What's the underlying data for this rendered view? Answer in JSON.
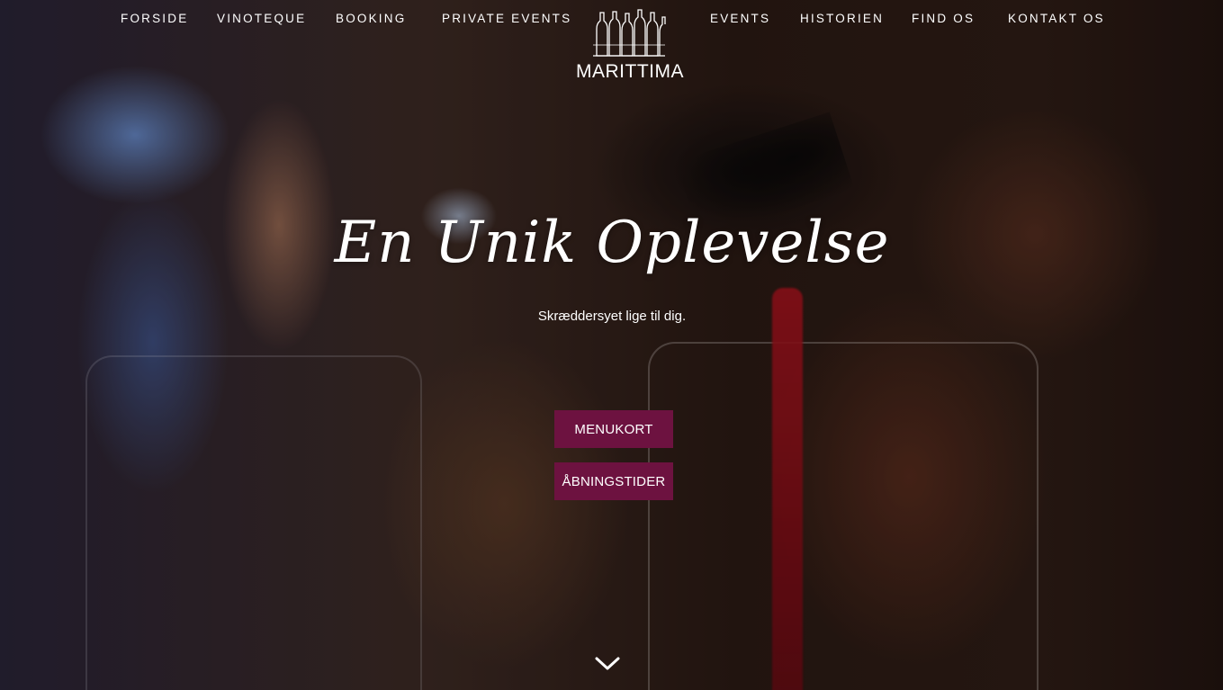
{
  "nav": {
    "left_links": [
      {
        "label": "FORSIDE"
      },
      {
        "label": "VINOTEQUE"
      },
      {
        "label": "BOOKING"
      },
      {
        "label": "PRIVATE EVENTS"
      }
    ],
    "right_links": [
      {
        "label": "EVENTS"
      },
      {
        "label": "HISTORIEN"
      },
      {
        "label": "FIND OS"
      },
      {
        "label": "KONTAKT OS"
      }
    ],
    "logo_text": "MARITTIMA",
    "logo_icon": "wine-bottles-icon"
  },
  "hero": {
    "headline": "En Unik Oplevelse",
    "subtitle": "Skræddersyet lige til dig.",
    "buttons": {
      "menu_label": "MENUKORT",
      "hours_label": "ÅBNINGSTIDER"
    },
    "scroll_icon": "chevron-down-icon"
  },
  "colors": {
    "button_bg": "#6d1240",
    "text": "#ffffff"
  }
}
